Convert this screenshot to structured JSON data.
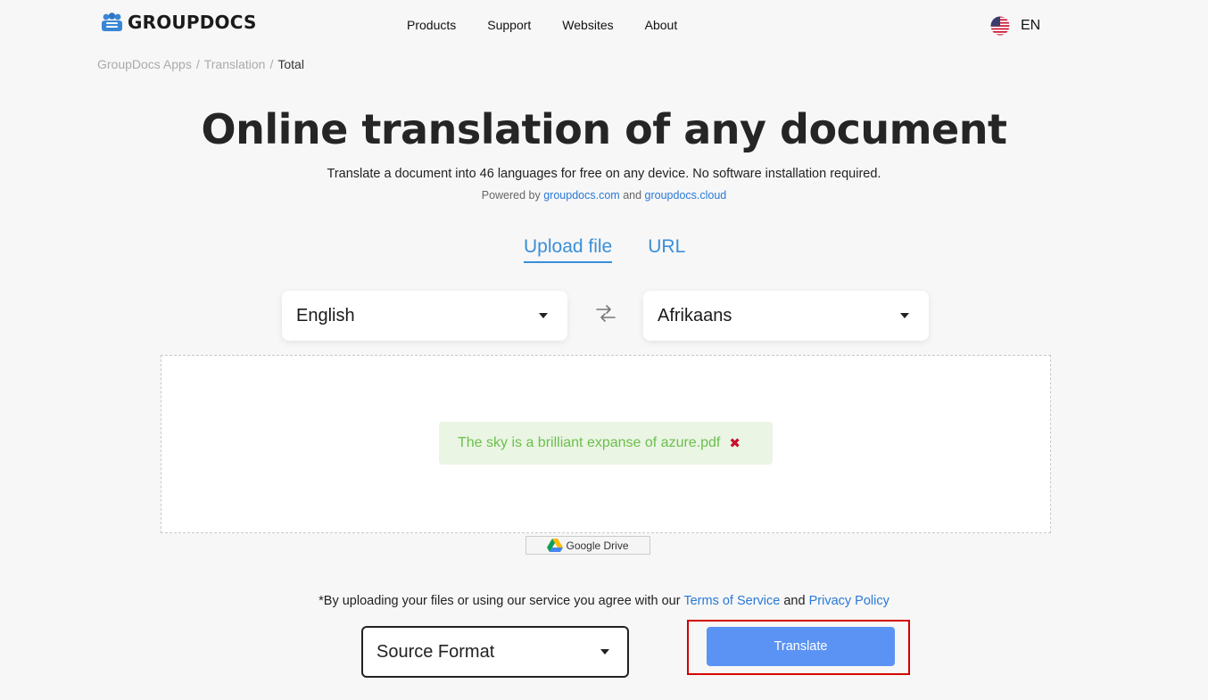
{
  "header": {
    "logo_text": "GROUPDOCS",
    "nav": [
      "Products",
      "Support",
      "Websites",
      "About"
    ],
    "language_code": "EN"
  },
  "breadcrumb": {
    "items": [
      "GroupDocs Apps",
      "Translation"
    ],
    "current": "Total",
    "separator": "/"
  },
  "hero": {
    "title": "Online translation of any document",
    "subtitle": "Translate a document into 46 languages for free on any device. No software installation required.",
    "powered_prefix": "Powered by",
    "powered_link1": "groupdocs.com",
    "powered_and": "and",
    "powered_link2": "groupdocs.cloud"
  },
  "tabs": {
    "upload": "Upload file",
    "url": "URL"
  },
  "languages": {
    "source": "English",
    "target": "Afrikaans"
  },
  "upload": {
    "file_name": "The sky is a brilliant expanse of azure.pdf",
    "remove_glyph": "✖",
    "google_drive_label": "Google Drive"
  },
  "agreement": {
    "prefix": "*By uploading your files or using our service you agree with our",
    "terms": "Terms of Service",
    "and": "and",
    "privacy": "Privacy Policy"
  },
  "controls": {
    "format_value": "Source Format",
    "translate_label": "Translate"
  },
  "colors": {
    "accent": "#3a8fd8",
    "button": "#5b93f5",
    "file_text": "#6cbf4b",
    "file_bg": "#eaf5e4",
    "remove": "#c8102e",
    "highlight": "#d40000"
  }
}
